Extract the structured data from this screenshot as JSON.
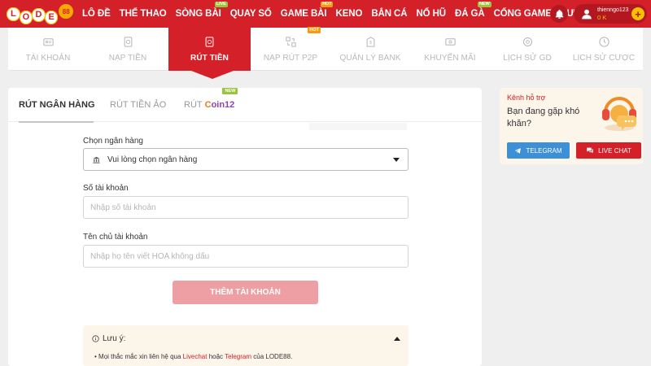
{
  "brand": {
    "logo_letters": [
      "L",
      "O",
      "D",
      "E"
    ],
    "logo_ball": "88"
  },
  "nav": {
    "items": [
      {
        "label": "LÔ ĐỀ",
        "badge": ""
      },
      {
        "label": "THỂ THAO",
        "badge": ""
      },
      {
        "label": "SÒNG BÀI",
        "badge": "LIVE"
      },
      {
        "label": "QUAY SỐ",
        "badge": ""
      },
      {
        "label": "GAME BÀI",
        "badge": "HOT"
      },
      {
        "label": "KENO",
        "badge": ""
      },
      {
        "label": "BẮN CÁ",
        "badge": ""
      },
      {
        "label": "NỔ HŨ",
        "badge": ""
      },
      {
        "label": "ĐÁ GÀ",
        "badge": "NEW"
      },
      {
        "label": "CỔNG GAMES",
        "badge": ""
      },
      {
        "label": "ƯU ĐÃI",
        "badge": ""
      }
    ]
  },
  "user": {
    "name": "thienngo123",
    "balance": "0 K",
    "plus": "+"
  },
  "subnav": {
    "items": [
      {
        "label": "TÀI KHOẢN",
        "icon": "user-card-icon"
      },
      {
        "label": "NẠP TIỀN",
        "icon": "deposit-icon"
      },
      {
        "label": "RÚT TIỀN",
        "icon": "withdraw-icon"
      },
      {
        "label": "NẠP RÚT P2P",
        "icon": "p2p-icon"
      },
      {
        "label": "QUẢN LÝ BANK",
        "icon": "bank-icon"
      },
      {
        "label": "KHUYẾN MÃI",
        "icon": "promotion-icon"
      },
      {
        "label": "LỊCH SỬ GD",
        "icon": "history-icon"
      },
      {
        "label": "LỊCH SỬ CƯỢC",
        "icon": "clock-icon"
      }
    ],
    "active_index": 2,
    "hot_badge": "HOT"
  },
  "tabs": {
    "bank": "RÚT NGÂN HÀNG",
    "crypto": "RÚT TIỀN ẢO",
    "coin_prefix": "RÚT",
    "coin_logo_c": "C",
    "coin_logo_rest": "oin12",
    "coin_badge": "NEW"
  },
  "form": {
    "bank_label": "Chọn ngân hàng",
    "bank_placeholder": "Vui lòng chọn ngân hàng",
    "account_label": "Số tài khoản",
    "account_placeholder": "Nhập số tài khoản",
    "holder_label": "Tên chủ tài khoản",
    "holder_placeholder": "Nhập họ tên viết HOA không dấu",
    "submit_label": "THÊM TÀI KHOẢN"
  },
  "note": {
    "title": "Lưu ý:",
    "line_prefix": "Mọi thắc mắc xin liên hệ qua",
    "livechat": "Livechat",
    "line_mid": "hoặc",
    "telegram": "Telegram",
    "line_suffix": "của LODE88."
  },
  "support": {
    "small": "Kênh hỗ trợ",
    "big": "Bạn đang gặp khó khăn?",
    "telegram_label": "TELEGRAM",
    "livechat_label": "LIVE CHAT"
  },
  "colors": {
    "brand_red": "#d42029",
    "accent_yellow": "#f5c000",
    "telegram_blue": "#3d8fd6",
    "disabled_pink": "#ee9fa3"
  }
}
